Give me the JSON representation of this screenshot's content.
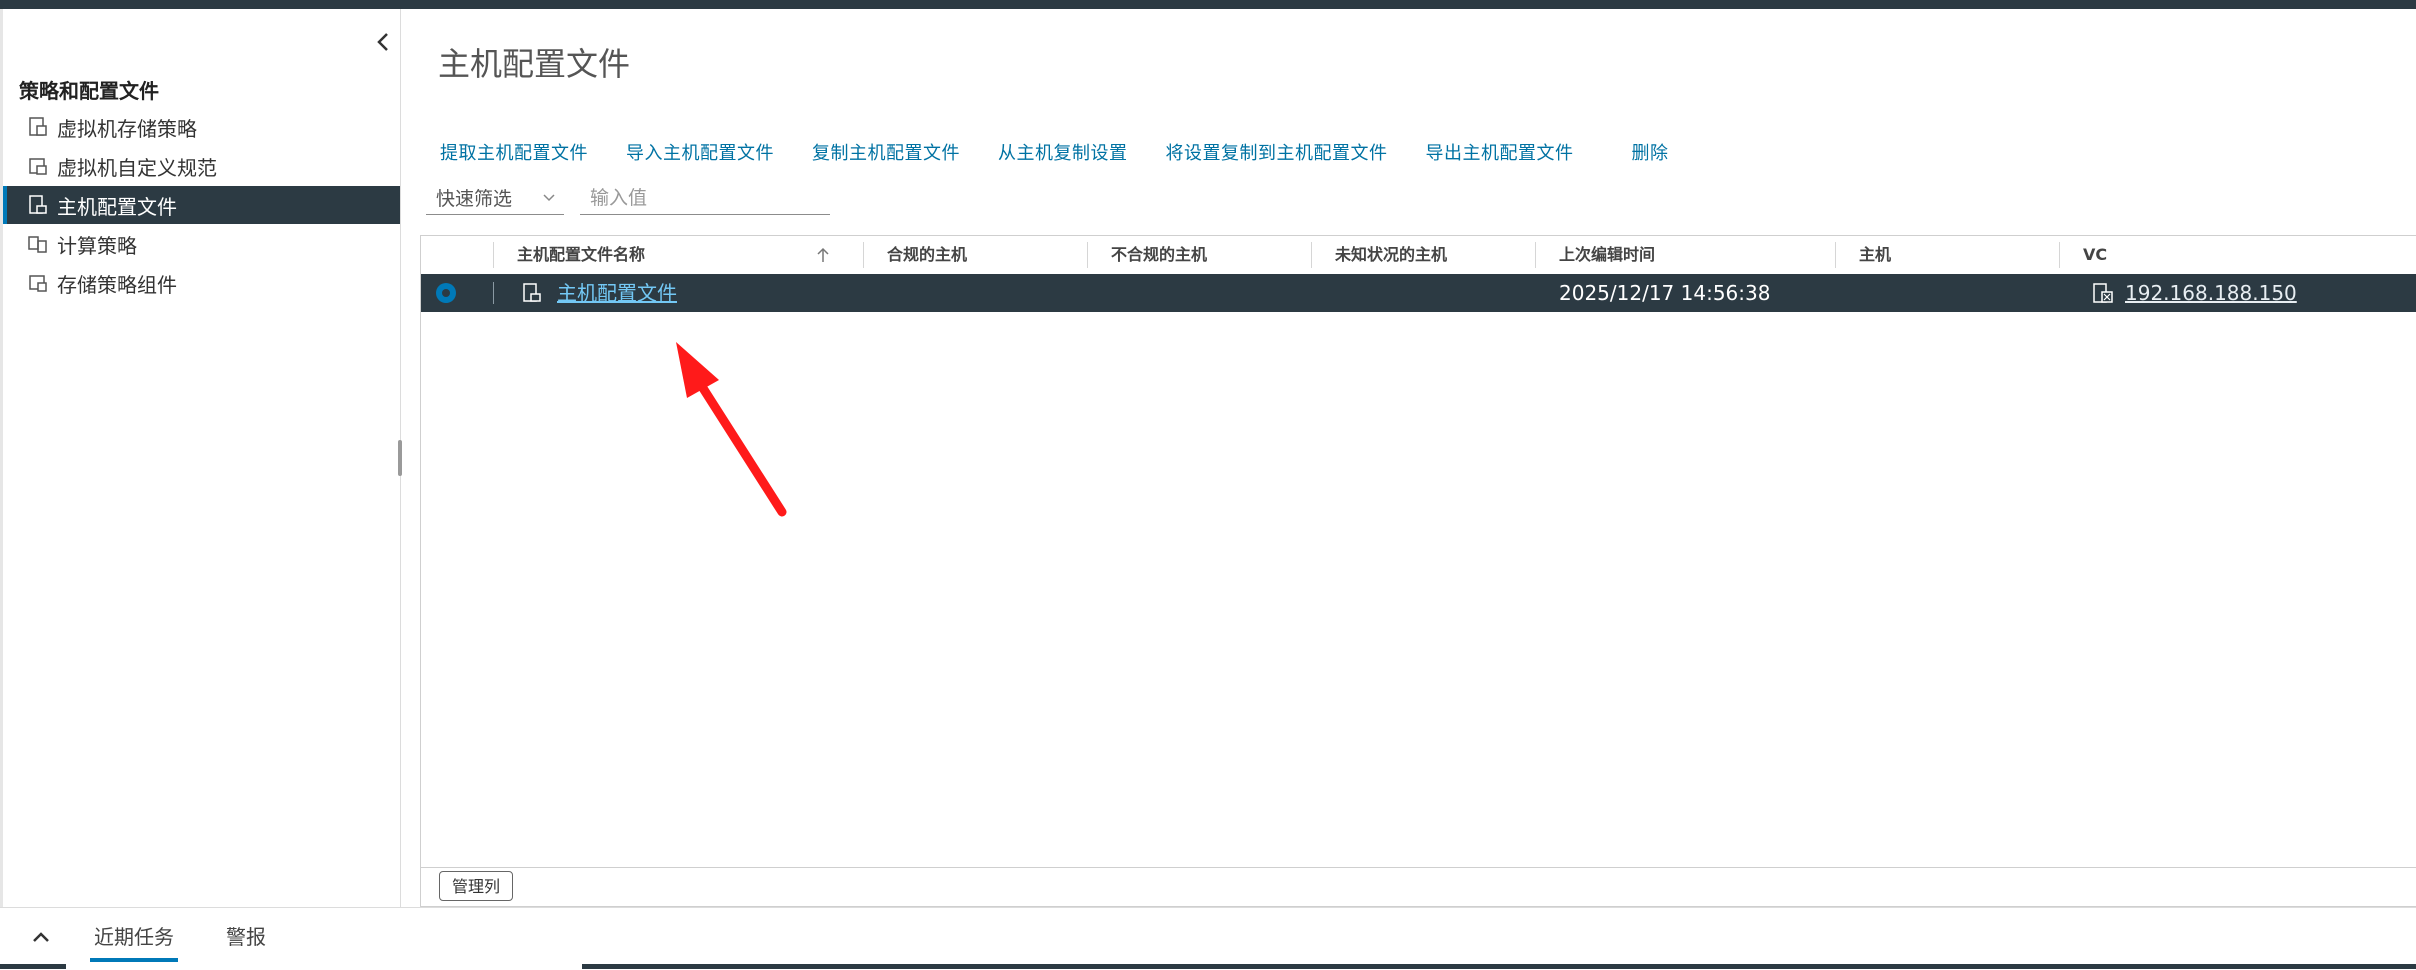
{
  "sidebar": {
    "section_title": "策略和配置文件",
    "items": [
      {
        "label": "虚拟机存储策略",
        "icon": "storage-policy-icon"
      },
      {
        "label": "虚拟机自定义规范",
        "icon": "customization-spec-icon"
      },
      {
        "label": "主机配置文件",
        "icon": "host-profile-icon",
        "active": true
      },
      {
        "label": "计算策略",
        "icon": "compute-policy-icon"
      },
      {
        "label": "存储策略组件",
        "icon": "storage-component-icon"
      }
    ]
  },
  "main": {
    "title": "主机配置文件",
    "toolbar": [
      "提取主机配置文件",
      "导入主机配置文件",
      "复制主机配置文件",
      "从主机复制设置",
      "将设置复制到主机配置文件",
      "导出主机配置文件",
      "删除"
    ],
    "filter": {
      "select_value": "快速筛选",
      "input_placeholder": "输入值"
    },
    "table": {
      "columns": [
        "主机配置文件名称",
        "合规的主机",
        "不合规的主机",
        "未知状况的主机",
        "上次编辑时间",
        "主机",
        "VC"
      ],
      "rows": [
        {
          "name": "主机配置文件",
          "compliant": "",
          "noncompliant": "",
          "unknown": "",
          "last_edited": "2025/12/17 14:56:38",
          "hosts": "",
          "vc": "192.168.188.150"
        }
      ]
    },
    "manage_columns_label": "管理列"
  },
  "bottom": {
    "tabs": [
      "近期任务",
      "警报"
    ]
  },
  "colors": {
    "header_dark": "#2c3a43",
    "link": "#0072a3",
    "accent": "#0079b8",
    "arrow": "#ff1a1a"
  }
}
